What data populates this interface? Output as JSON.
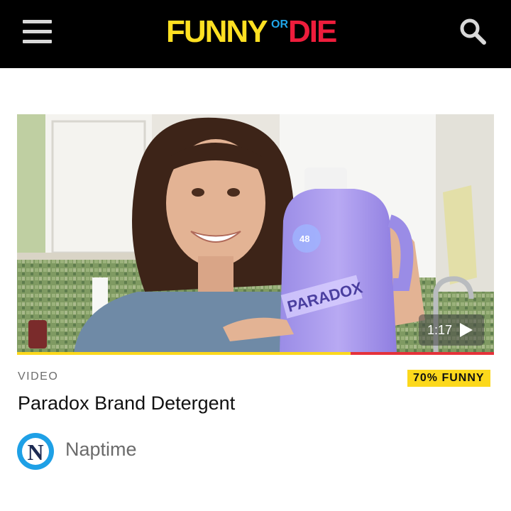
{
  "header": {
    "logo_word1": "FUNNY",
    "logo_or": "OR",
    "logo_word2": "DIE",
    "icons": {
      "menu": "hamburger-menu-icon",
      "search": "search-icon"
    }
  },
  "video": {
    "duration": "1:17",
    "progress_fraction": 0.7,
    "bottle_text": "PARADOX",
    "bottle_loads": "48"
  },
  "meta": {
    "category": "VIDEO",
    "rating": "70% FUNNY",
    "title": "Paradox Brand Detergent",
    "author": "Naptime",
    "author_initial": "N"
  },
  "colors": {
    "header_bg": "#000000",
    "logo_yellow": "#ffe022",
    "logo_blue": "#20a5e8",
    "logo_red": "#ee1d3c",
    "rating_badge": "#fcd81c",
    "progress_played": "#fcd81c",
    "progress_remaining": "#e5323a",
    "avatar_ring": "#1ea0e6"
  }
}
